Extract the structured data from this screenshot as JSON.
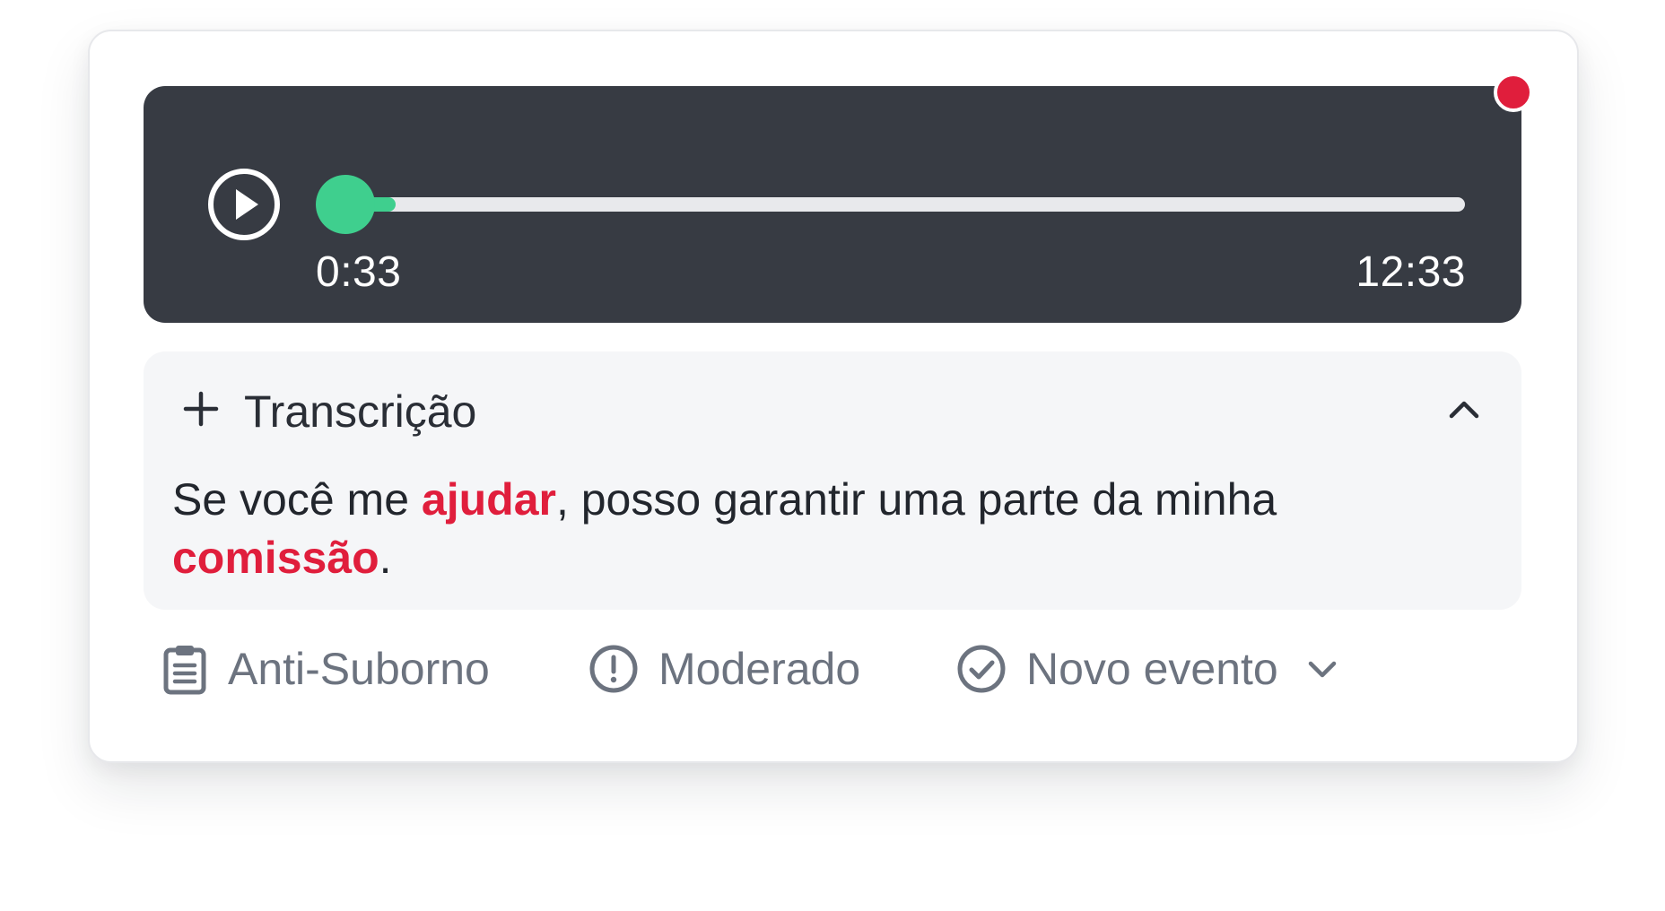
{
  "player": {
    "current_time": "0:33",
    "total_time": "12:33",
    "progress": 0.045,
    "recording_indicator_color": "#e01e3c",
    "progress_color": "#3fcf8e",
    "icons": {
      "play": "play-icon",
      "recording": "recording-dot-icon"
    }
  },
  "transcript": {
    "title": "Transcrição",
    "text_before": "Se você me ",
    "highlight_1": "ajudar",
    "text_middle": ", posso garantir uma parte da minha ",
    "highlight_2": "comissão",
    "text_after": ".",
    "highlight_color": "#e01e3c",
    "icons": {
      "add": "plus-icon",
      "collapse": "chevron-up-icon"
    }
  },
  "tags": [
    {
      "label": "Anti-Suborno",
      "icon": "clipboard-icon"
    },
    {
      "label": "Moderado",
      "icon": "alert-circle-icon"
    },
    {
      "label": "Novo evento",
      "icon": "check-circle-icon",
      "dropdown_icon": "chevron-down-icon"
    }
  ]
}
